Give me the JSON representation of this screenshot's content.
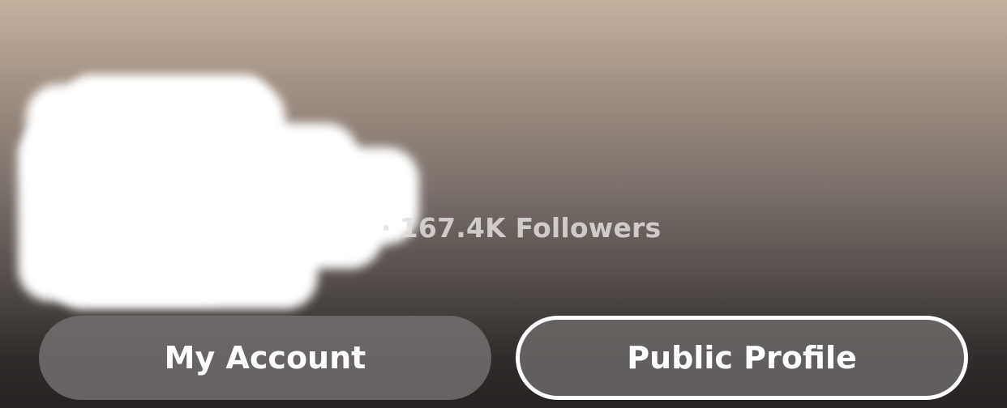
{
  "profile": {
    "name": "",
    "stats_separator": "·",
    "followers_text": "167.4K Followers"
  },
  "buttons": {
    "my_account_label": "My Account",
    "public_profile_label": "Public Profile"
  }
}
